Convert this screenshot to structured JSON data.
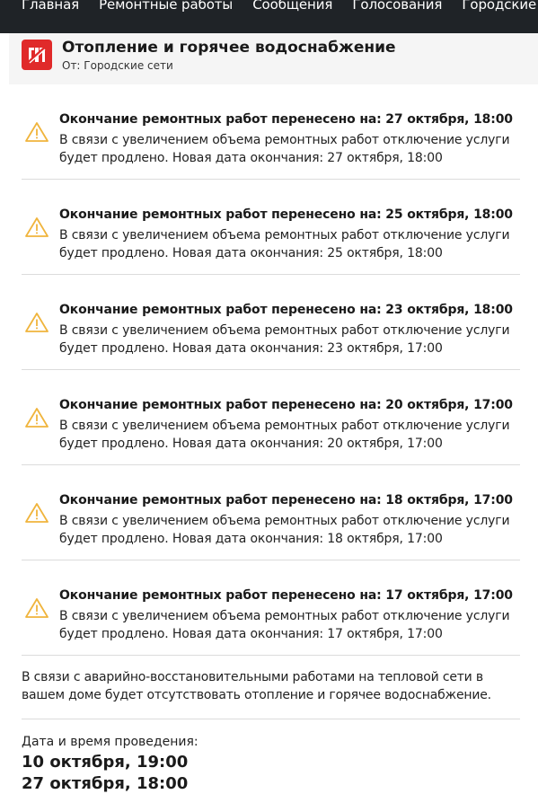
{
  "nav": {
    "items": [
      "Главная",
      "Ремонтные работы",
      "Сообщения",
      "Голосования",
      "Городские опове"
    ]
  },
  "header": {
    "title": "Отопление и горячее водоснабжение",
    "source": "От: Городские сети",
    "logo_color": "#e02a2a"
  },
  "updates": [
    {
      "title": "Окончание ремонтных работ перенесено на: 27 октября, 18:00",
      "body": "В связи с увеличением объема ремонтных работ отключение услуги будет продлено. Новая дата окончания: 27 октября, 18:00",
      "icon": "warning-icon"
    },
    {
      "title": "Окончание ремонтных работ перенесено на: 25 октября, 18:00",
      "body": "В связи с увеличением объема ремонтных работ отключение услуги будет продлено. Новая дата окончания: 25 октября, 18:00",
      "icon": "warning-icon"
    },
    {
      "title": "Окончание ремонтных работ перенесено на: 23 октября, 18:00",
      "body": "В связи с увеличением объема ремонтных работ отключение услуги будет продлено. Новая дата окончания: 23 октября, 17:00",
      "icon": "warning-icon"
    },
    {
      "title": "Окончание ремонтных работ перенесено на: 20 октября, 17:00",
      "body": "В связи с увеличением объема ремонтных работ отключение услуги будет продлено. Новая дата окончания: 20 октября, 17:00",
      "icon": "warning-icon"
    },
    {
      "title": "Окончание ремонтных работ перенесено на: 18 октября, 17:00",
      "body": "В связи с увеличением объема ремонтных работ отключение услуги будет продлено. Новая дата окончания: 18 октября, 17:00",
      "icon": "warning-icon"
    },
    {
      "title": "Окончание ремонтных работ перенесено на: 17 октября, 17:00",
      "body": "В связи с увеличением объема ремонтных работ отключение услуги будет продлено. Новая дата окончания: 17 октября, 17:00",
      "icon": "warning-icon"
    }
  ],
  "description": "В связи с аварийно-восстановительными работами на тепловой сети в вашем доме будет отсутствовать отопление и горячее водоснабжение.",
  "schedule": {
    "label": "Дата и время проведения:",
    "start": "10 октября, 19:00",
    "end": "27 октября, 18:00"
  },
  "colors": {
    "nav_bg": "#1f2327",
    "warning": "#f0b43c"
  }
}
